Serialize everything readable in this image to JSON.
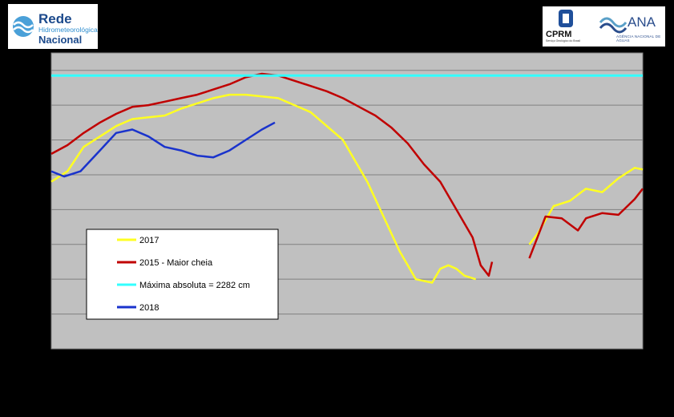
{
  "logos": {
    "left": {
      "line1": "Rede",
      "line2": "Hidrometeorológica",
      "line3": "Nacional"
    },
    "right": {
      "cprm": "CPRM",
      "cprm_sub": "Serviço Geológico do Brasil",
      "ana": "ANA",
      "ana_sub": "AGÊNCIA NACIONAL DE ÁGUAS"
    }
  },
  "colors": {
    "background": "#000000",
    "plot_area": "#c0c0c0",
    "grid": "#808080",
    "s2017": "#ffff22",
    "s2015": "#c00000",
    "max": "#33ffff",
    "s2018": "#1a33cc"
  },
  "chart_data": {
    "type": "line",
    "title": "",
    "xlabel": "",
    "ylabel": "",
    "xlim": [
      0,
      365
    ],
    "ylim": [
      0,
      8.5
    ],
    "grid": true,
    "legend_position": "bottom-left",
    "series": [
      {
        "name": "2017",
        "color": "#ffff22",
        "points": [
          [
            0,
            4.8
          ],
          [
            10,
            5.1
          ],
          [
            20,
            5.8
          ],
          [
            30,
            6.1
          ],
          [
            40,
            6.4
          ],
          [
            50,
            6.6
          ],
          [
            60,
            6.65
          ],
          [
            70,
            6.7
          ],
          [
            80,
            6.9
          ],
          [
            90,
            7.05
          ],
          [
            100,
            7.2
          ],
          [
            110,
            7.3
          ],
          [
            120,
            7.3
          ],
          [
            140,
            7.2
          ],
          [
            160,
            6.8
          ],
          [
            180,
            6.0
          ],
          [
            195,
            4.8
          ],
          [
            205,
            3.8
          ],
          [
            215,
            2.8
          ],
          [
            225,
            2.0
          ],
          [
            235,
            1.9
          ],
          [
            240,
            2.3
          ],
          [
            245,
            2.4
          ],
          [
            250,
            2.3
          ],
          [
            255,
            2.1
          ],
          [
            262,
            2.0
          ],
          [
            262,
            null
          ],
          [
            295,
            3.0
          ],
          [
            300,
            3.3
          ],
          [
            310,
            4.1
          ],
          [
            320,
            4.25
          ],
          [
            330,
            4.6
          ],
          [
            340,
            4.5
          ],
          [
            350,
            4.9
          ],
          [
            360,
            5.2
          ],
          [
            365,
            5.15
          ]
        ]
      },
      {
        "name": "2015 - Maior cheia",
        "color": "#c00000",
        "points": [
          [
            0,
            5.6
          ],
          [
            10,
            5.85
          ],
          [
            20,
            6.2
          ],
          [
            30,
            6.5
          ],
          [
            40,
            6.75
          ],
          [
            50,
            6.95
          ],
          [
            60,
            7.0
          ],
          [
            70,
            7.1
          ],
          [
            80,
            7.2
          ],
          [
            90,
            7.3
          ],
          [
            100,
            7.45
          ],
          [
            110,
            7.6
          ],
          [
            120,
            7.8
          ],
          [
            130,
            7.9
          ],
          [
            140,
            7.85
          ],
          [
            150,
            7.7
          ],
          [
            160,
            7.55
          ],
          [
            170,
            7.4
          ],
          [
            180,
            7.2
          ],
          [
            190,
            6.95
          ],
          [
            200,
            6.7
          ],
          [
            210,
            6.35
          ],
          [
            220,
            5.9
          ],
          [
            230,
            5.3
          ],
          [
            240,
            4.8
          ],
          [
            250,
            4.0
          ],
          [
            260,
            3.2
          ],
          [
            265,
            2.4
          ],
          [
            270,
            2.1
          ],
          [
            272,
            2.5
          ],
          [
            272,
            null
          ],
          [
            295,
            2.6
          ],
          [
            300,
            3.2
          ],
          [
            305,
            3.8
          ],
          [
            315,
            3.75
          ],
          [
            325,
            3.4
          ],
          [
            330,
            3.75
          ],
          [
            340,
            3.9
          ],
          [
            350,
            3.85
          ],
          [
            360,
            4.3
          ],
          [
            365,
            4.6
          ]
        ]
      },
      {
        "name": "Máxima absoluta = 2282 cm",
        "color": "#33ffff",
        "points": [
          [
            0,
            7.85
          ],
          [
            365,
            7.85
          ]
        ]
      },
      {
        "name": "2018",
        "color": "#1a33cc",
        "points": [
          [
            0,
            5.1
          ],
          [
            8,
            4.95
          ],
          [
            18,
            5.1
          ],
          [
            30,
            5.7
          ],
          [
            40,
            6.2
          ],
          [
            50,
            6.3
          ],
          [
            60,
            6.1
          ],
          [
            70,
            5.8
          ],
          [
            80,
            5.7
          ],
          [
            90,
            5.55
          ],
          [
            100,
            5.5
          ],
          [
            110,
            5.7
          ],
          [
            120,
            6.0
          ],
          [
            130,
            6.3
          ],
          [
            138,
            6.5
          ]
        ]
      }
    ]
  }
}
